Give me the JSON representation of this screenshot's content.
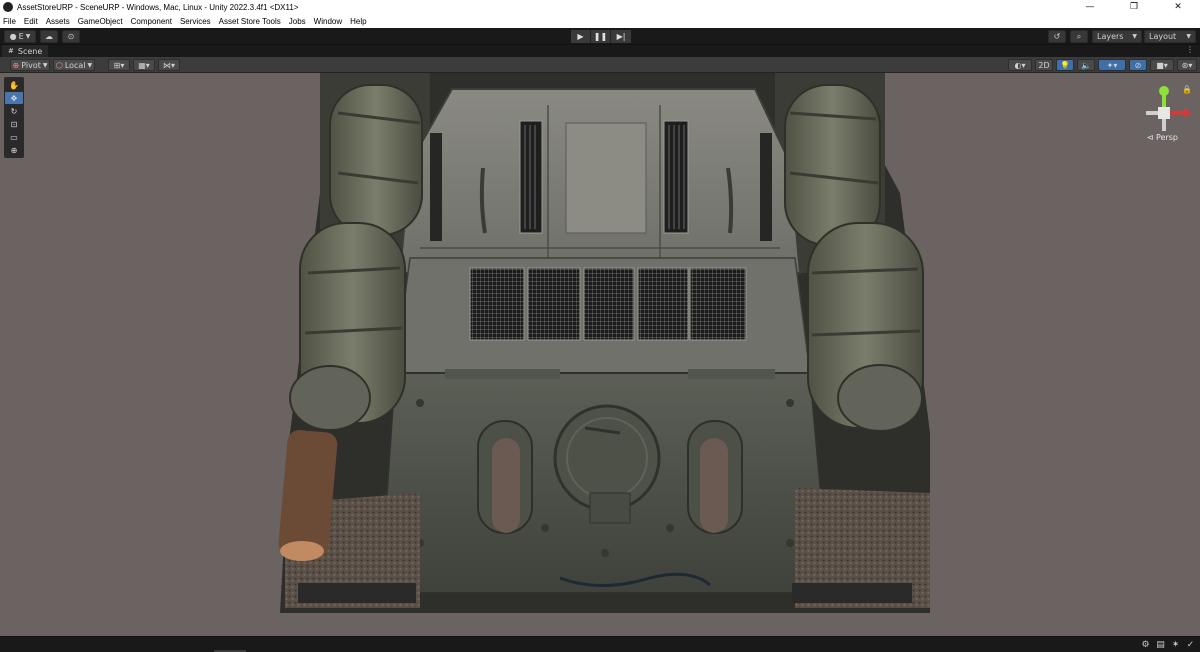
{
  "window": {
    "title": "AssetStoreURP - SceneURP - Windows, Mac, Linux - Unity 2022.3.4f1 <DX11>",
    "controls": [
      "—",
      "❐",
      "✕"
    ]
  },
  "menu": [
    "File",
    "Edit",
    "Assets",
    "GameObject",
    "Component",
    "Services",
    "Asset Store Tools",
    "Jobs",
    "Window",
    "Help"
  ],
  "toolbar": {
    "account_label": "E",
    "layers_label": "Layers",
    "layout_label": "Layout"
  },
  "scene_tab": {
    "label": "Scene"
  },
  "scene_toolbar": {
    "pivot_label": "Pivot",
    "local_label": "Local",
    "mode_2d_label": "2D"
  },
  "gizmo": {
    "projection_label": "Persp"
  },
  "colors": {
    "scene_background": "#6b6262",
    "active_tool": "#4a76b0",
    "gizmo_x": "#d33a3a",
    "gizmo_y": "#8ee03a"
  }
}
